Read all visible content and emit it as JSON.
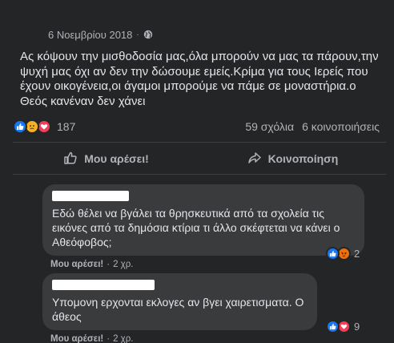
{
  "post": {
    "date": "6 Νοεμβρίου 2018",
    "separator": "·",
    "privacy_icon": "globe-icon",
    "text": "Ας κόψουν την μισθοδοσία μας,όλα μπορούν να μας τα πάρουν,την ψυχή μας όχι αν δεν την δώσουμε εμείς.Κρίμα για τους Ιερείς που έχουν οικογένεια,οι άγαμοι μπορούμε να πάμε σε μοναστήρια.ο Θεός κανέναν δεν χάνει",
    "reactions": {
      "icons": [
        "like-icon",
        "sad-icon",
        "love-icon"
      ],
      "count": "187"
    },
    "comments_count": "59 σχόλια",
    "shares_count": "6 κοινοποιήσεις"
  },
  "actions": {
    "like_label": "Μου αρέσει!",
    "share_label": "Κοινοποίηση"
  },
  "comments": [
    {
      "author_redacted": true,
      "text": "Εδώ θέλει να βγάλει τα θρησκευτικά από τα σχολεία τις εικόνες από τα δημόσια κτίρια τι άλλο σκέφτεται να κάνει ο Αθεόφοβος;",
      "like_label": "Μου αρέσει!",
      "separator": "·",
      "time": "2 χρ.",
      "reactions": [
        "like-icon",
        "angry-icon"
      ],
      "reaction_count": "2"
    },
    {
      "author_redacted": true,
      "text": "Υπομονη ερχονται εκλογες αν βγει χαιρετισματα. Ο άθεος",
      "like_label": "Μου αρέσει!",
      "separator": "·",
      "time": "2 χρ.",
      "reactions": [
        "like-icon",
        "love-icon"
      ],
      "reaction_count": "9"
    }
  ],
  "colors": {
    "background": "#242526",
    "bubble": "#3a3b3c",
    "text_primary": "#e4e6eb",
    "text_secondary": "#b0b3b8",
    "like_blue": "#1877f2",
    "love_red": "#f33e58",
    "sad_yellow": "#f7b125",
    "angry_orange": "#e9710f"
  }
}
